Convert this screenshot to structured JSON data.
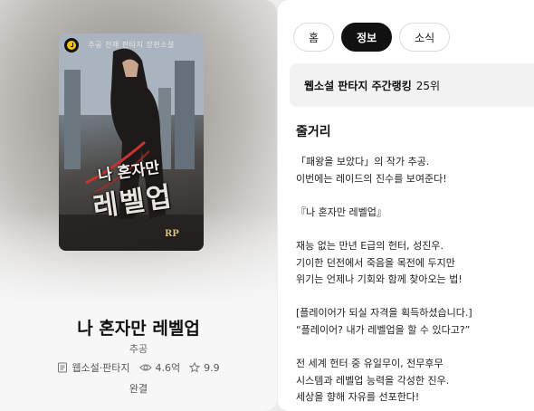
{
  "book": {
    "cover": {
      "top_text": "추공 천재 판타지 장편소설",
      "title_line1": "나 혼자만",
      "title_line2": "레벨업",
      "publisher_mark": "RP"
    },
    "title": "나 혼자만 레벨업",
    "author": "추공",
    "genre": "웹소설·판타지",
    "views": "4.6억",
    "rating": "9.9",
    "status": "완결"
  },
  "tabs": [
    {
      "label": "홈",
      "active": false
    },
    {
      "label": "정보",
      "active": true
    },
    {
      "label": "소식",
      "active": false
    }
  ],
  "ranking": {
    "label": "웹소설 판타지 주간랭킹",
    "value": "25위"
  },
  "synopsis": {
    "heading": "줄거리",
    "lines": [
      "「패왕을 보았다」의 작가 추공.",
      "이번에는 레이드의 진수를 보여준다!",
      "",
      "『나 혼자만 레벨업』",
      "",
      "재능 없는 만년 E급의 헌터, 성진우.",
      "기이한 던전에서 죽음을 목전에 두지만",
      "위기는 언제나 기회와 함께 찾아오는 법!",
      "",
      "[플레이어가 되실 자격을 획득하셨습니다.]",
      "“플레이어? 내가 레벨업을 할 수 있다고?”",
      "",
      "전 세계 헌터 중 유일무이, 전무후무",
      "시스템과 레벨업 능력을 각성한 진우.",
      "세상을 향해 자유를 선포한다!"
    ]
  }
}
